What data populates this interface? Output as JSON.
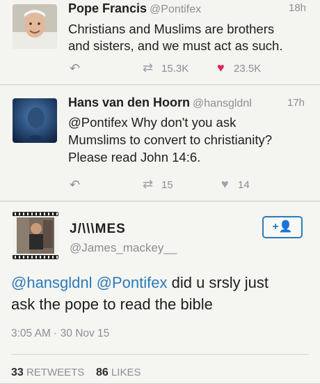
{
  "tweets": [
    {
      "name": "Pope Francis",
      "handle": "@Pontifex",
      "time": "18h",
      "text_line1": "Christians and Muslims are brothers",
      "text_line2": "and sisters, and we must act as such.",
      "retweets": "15.3K",
      "likes": "23.5K"
    },
    {
      "name": "Hans van den Hoorn",
      "handle": "@hansgldnl",
      "time": "17h",
      "text_line1": "@Pontifex Why don't you ask",
      "text_line2": "Mumslims to convert to christianity?",
      "text_line3": "Please read John 14:6.",
      "retweets": "15",
      "likes": "14"
    }
  ],
  "reply": {
    "name": "J/\\\\\\MES",
    "handle": "@James_mackey__",
    "mention1": "@hansgldnl",
    "mention2": "@Pontifex",
    "text_part1": " did u srsly just",
    "text_line2": "ask the pope to read the bible",
    "timestamp": "3:05 AM · 30 Nov 15",
    "retweet_count": "33",
    "retweets_label": "RETWEETS",
    "like_count": "86",
    "likes_label": "LIKES",
    "follow_icon": "+👤"
  },
  "icons": {
    "reply": "reply-arrow-icon",
    "retweet": "retweet-icon",
    "like": "heart-icon",
    "follow": "add-user-icon"
  },
  "colors": {
    "link": "#2b7bb9",
    "heart_active": "#e0245e",
    "muted": "#8a8f95"
  }
}
